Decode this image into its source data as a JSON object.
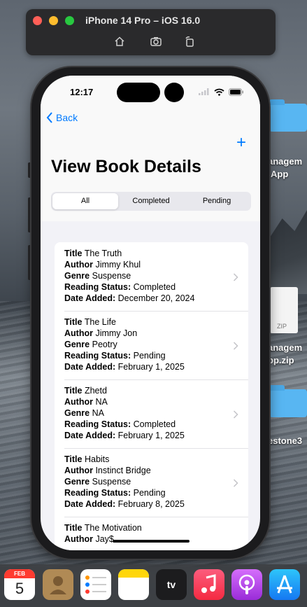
{
  "simulator": {
    "title": "iPhone 14 Pro – iOS 16.0"
  },
  "status_bar": {
    "time": "12:17"
  },
  "nav": {
    "back_label": "Back",
    "add_symbol": "+"
  },
  "page": {
    "title": "View Book Details"
  },
  "filter": {
    "segments": [
      "All",
      "Completed",
      "Pending"
    ],
    "selected": "All"
  },
  "labels": {
    "title": "Title",
    "author": "Author",
    "genre": "Genre",
    "status": "Reading Status:",
    "date": "Date Added:"
  },
  "books": [
    {
      "title": "The Truth",
      "author": "Jimmy Khul",
      "genre": "Suspense",
      "status": "Completed",
      "date": "December 20, 2024"
    },
    {
      "title": "The Life",
      "author": "Jimmy Jon",
      "genre": "Peotry",
      "status": "Pending",
      "date": "February 1, 2025"
    },
    {
      "title": "Zhetd",
      "author": "NA",
      "genre": "NA",
      "status": "Completed",
      "date": "February 1, 2025"
    },
    {
      "title": "Habits",
      "author": "Instinct Bridge",
      "genre": "Suspense",
      "status": "Pending",
      "date": "February 8, 2025"
    },
    {
      "title": "The Motivation",
      "author": "Jay$"
    }
  ],
  "desktop": {
    "items": [
      {
        "label_line1": "anagem",
        "label_line2": "App"
      },
      {
        "label_line1": "anagem",
        "label_line2": "pp.zip",
        "badge": "ZIP"
      },
      {
        "label_line1": "estone3"
      }
    ]
  },
  "dock": {
    "calendar_month": "FEB",
    "calendar_day": "5",
    "tv_label": "tv"
  },
  "colors": {
    "accent": "#007aff",
    "screen_bg": "#f2f2f7"
  }
}
